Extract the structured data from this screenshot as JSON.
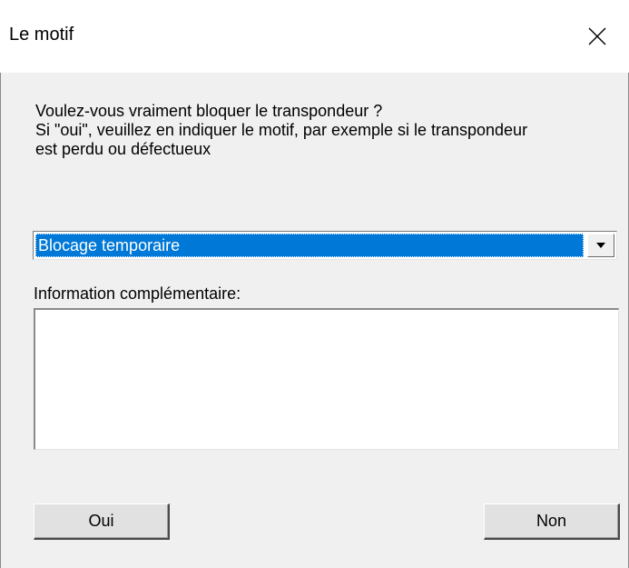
{
  "window": {
    "title": "Le motif",
    "close_icon": "close-icon"
  },
  "message": {
    "line1": "Voulez-vous vraiment bloquer le transpondeur ?",
    "line2": "Si \"oui\", veuillez en indiquer le motif, par exemple si le transpondeur",
    "line3": "est perdu ou défectueux"
  },
  "reason_combo": {
    "selected": "Blocage temporaire",
    "dropdown_icon": "chevron-down-icon"
  },
  "info": {
    "label": "Information complémentaire:",
    "value": ""
  },
  "buttons": {
    "yes_label": "Oui",
    "no_label": "Non"
  },
  "colors": {
    "selection": "#0078d7",
    "dialog_bg": "#f0f0f0"
  }
}
